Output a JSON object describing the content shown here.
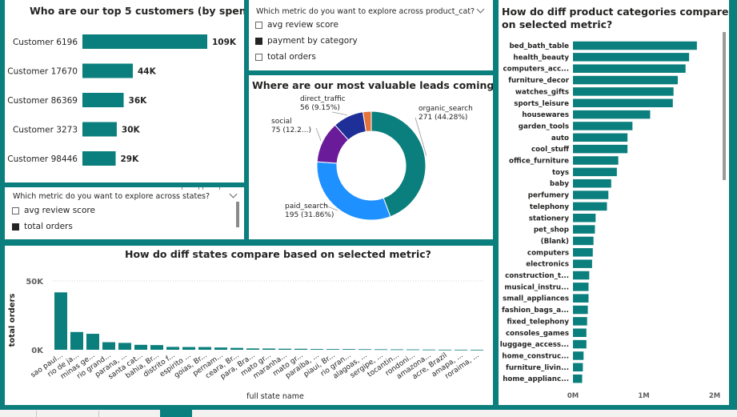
{
  "top_customers": {
    "title": "Who are our top 5 customers (by spend)?",
    "chart_data": {
      "type": "bar",
      "orientation": "horizontal",
      "categories": [
        "Customer 6196",
        "Customer 17670",
        "Customer 86369",
        "Customer 3273",
        "Customer 98446"
      ],
      "values": [
        109000,
        44000,
        36000,
        30000,
        29000
      ],
      "data_labels": [
        "109K",
        "44K",
        "36K",
        "30K",
        "29K"
      ],
      "color": "#0b7f7d"
    }
  },
  "product_cat_slicer": {
    "header": "Which metric do you want to explore across product_cat?",
    "options": [
      {
        "label": "avg review score",
        "checked": false
      },
      {
        "label": "payment by category",
        "checked": true
      },
      {
        "label": "total orders",
        "checked": false
      }
    ]
  },
  "states_slicer": {
    "header": "Which metric do you want to explore across states?",
    "options": [
      {
        "label": "avg review score",
        "checked": false
      },
      {
        "label": "total orders",
        "checked": true
      }
    ]
  },
  "leads": {
    "title": "Where are our most valuable leads coming from?",
    "chart_data": {
      "type": "pie",
      "donut": true,
      "slices": [
        {
          "name": "organic_search",
          "value": 271,
          "label": "271 (44.28%)",
          "color": "#0b7f7d"
        },
        {
          "name": "paid_search",
          "value": 195,
          "label": "195 (31.86%)",
          "color": "#1e90ff"
        },
        {
          "name": "social",
          "value": 75,
          "label": "75 (12.2...)",
          "color": "#6a1b9a"
        },
        {
          "name": "direct_traffic",
          "value": 56,
          "label": "56 (9.15%)",
          "color": "#1f2f98"
        },
        {
          "name": "",
          "value": 15,
          "label": "",
          "color": "#e6733a"
        }
      ]
    }
  },
  "states": {
    "title": "How do diff states compare based on selected metric?",
    "chart_data": {
      "type": "bar",
      "xlabel": "full state name",
      "ylabel": "total orders",
      "ylim": [
        0,
        50000
      ],
      "y_ticks": [
        "0K",
        "50K"
      ],
      "color": "#0b7f7d",
      "categories": [
        "sao paul...",
        "rio de ja...",
        "minas ge...",
        "rio grand...",
        "parana, ...",
        "santa cat...",
        "bahia, Br...",
        "distrito f...",
        "espirito ...",
        "goias, Br...",
        "pernam...",
        "ceara, Br...",
        "para, Bra...",
        "mato gr...",
        "maranha...",
        "mato gr...",
        "paraiba, ...",
        "piaui, Br...",
        "rio gran...",
        "alagoas, ...",
        "sergipe, ...",
        "tocantin...",
        "rondoni...",
        "amazona...",
        "acre, Brazil",
        "amapa, ...",
        "roraima, ..."
      ],
      "values": [
        41700,
        12900,
        11600,
        5500,
        5000,
        3600,
        3400,
        2100,
        2000,
        2000,
        1650,
        1340,
        970,
        900,
        750,
        720,
        540,
        500,
        490,
        410,
        350,
        280,
        250,
        150,
        80,
        70,
        46
      ]
    }
  },
  "product_categories": {
    "title_line1": "How do diff product categories compare based",
    "title_line2": "on selected metric?",
    "chart_data": {
      "type": "bar",
      "orientation": "horizontal",
      "color": "#0b7f7d",
      "xlim": [
        0,
        2000000
      ],
      "x_ticks": [
        "0M",
        "1M",
        "2M"
      ],
      "categories": [
        "bed_bath_table",
        "health_beauty",
        "computers_acc...",
        "furniture_decor",
        "watches_gifts",
        "sports_leisure",
        "housewares",
        "garden_tools",
        "auto",
        "cool_stuff",
        "office_furniture",
        "toys",
        "baby",
        "perfumery",
        "telephony",
        "stationery",
        "pet_shop",
        "(Blank)",
        "computers",
        "electronics",
        "construction_t...",
        "musical_instru...",
        "small_appliances",
        "fashion_bags_a...",
        "fixed_telephony",
        "consoles_games",
        "luggage_access...",
        "home_construc...",
        "furniture_livin...",
        "home_applianc..."
      ],
      "values": [
        1750000,
        1640000,
        1590000,
        1480000,
        1420000,
        1410000,
        1090000,
        840000,
        770000,
        770000,
        640000,
        620000,
        540000,
        500000,
        480000,
        320000,
        310000,
        290000,
        280000,
        270000,
        230000,
        220000,
        220000,
        210000,
        200000,
        190000,
        190000,
        150000,
        140000,
        130000
      ]
    }
  }
}
